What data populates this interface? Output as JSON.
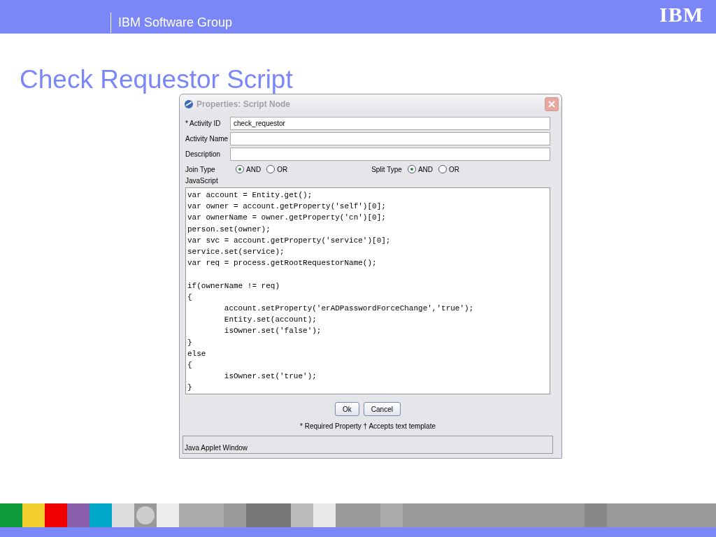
{
  "header": {
    "group": "IBM Software Group",
    "logo": "IBM"
  },
  "title": "Check Requestor Script",
  "dialog": {
    "title": "Properties: Script Node",
    "fields": [
      {
        "label": "* Activity ID",
        "value": "check_requestor"
      },
      {
        "label": "Activity Name"
      },
      {
        "label": "Description"
      }
    ],
    "radio_groups": [
      {
        "label": "Join Type",
        "options": [
          {
            "label": "AND",
            "selected": true
          },
          {
            "label": "OR",
            "selected": false
          }
        ]
      },
      {
        "label": "Split Type",
        "options": [
          {
            "label": "AND",
            "selected": true
          },
          {
            "label": "OR",
            "selected": false
          }
        ]
      }
    ],
    "script_label": "JavaScript",
    "code": "var account = Entity.get();\nvar owner = account.getProperty('self')[0];\nvar ownerName = owner.getProperty('cn')[0];\nperson.set(owner);\nvar svc = account.getProperty('service')[0];\nservice.set(service);\nvar req = process.getRootRequestorName();\n\nif(ownerName != req)\n{\n        account.setProperty('erADPasswordForceChange','true');\n        Entity.set(account);\n        isOwner.set('false');\n}\nelse\n{\n        isOwner.set('true');\n}",
    "buttons": [
      "Ok",
      "Cancel"
    ],
    "footnote": "* Required Property † Accepts text template",
    "status": "Java Applet Window"
  }
}
